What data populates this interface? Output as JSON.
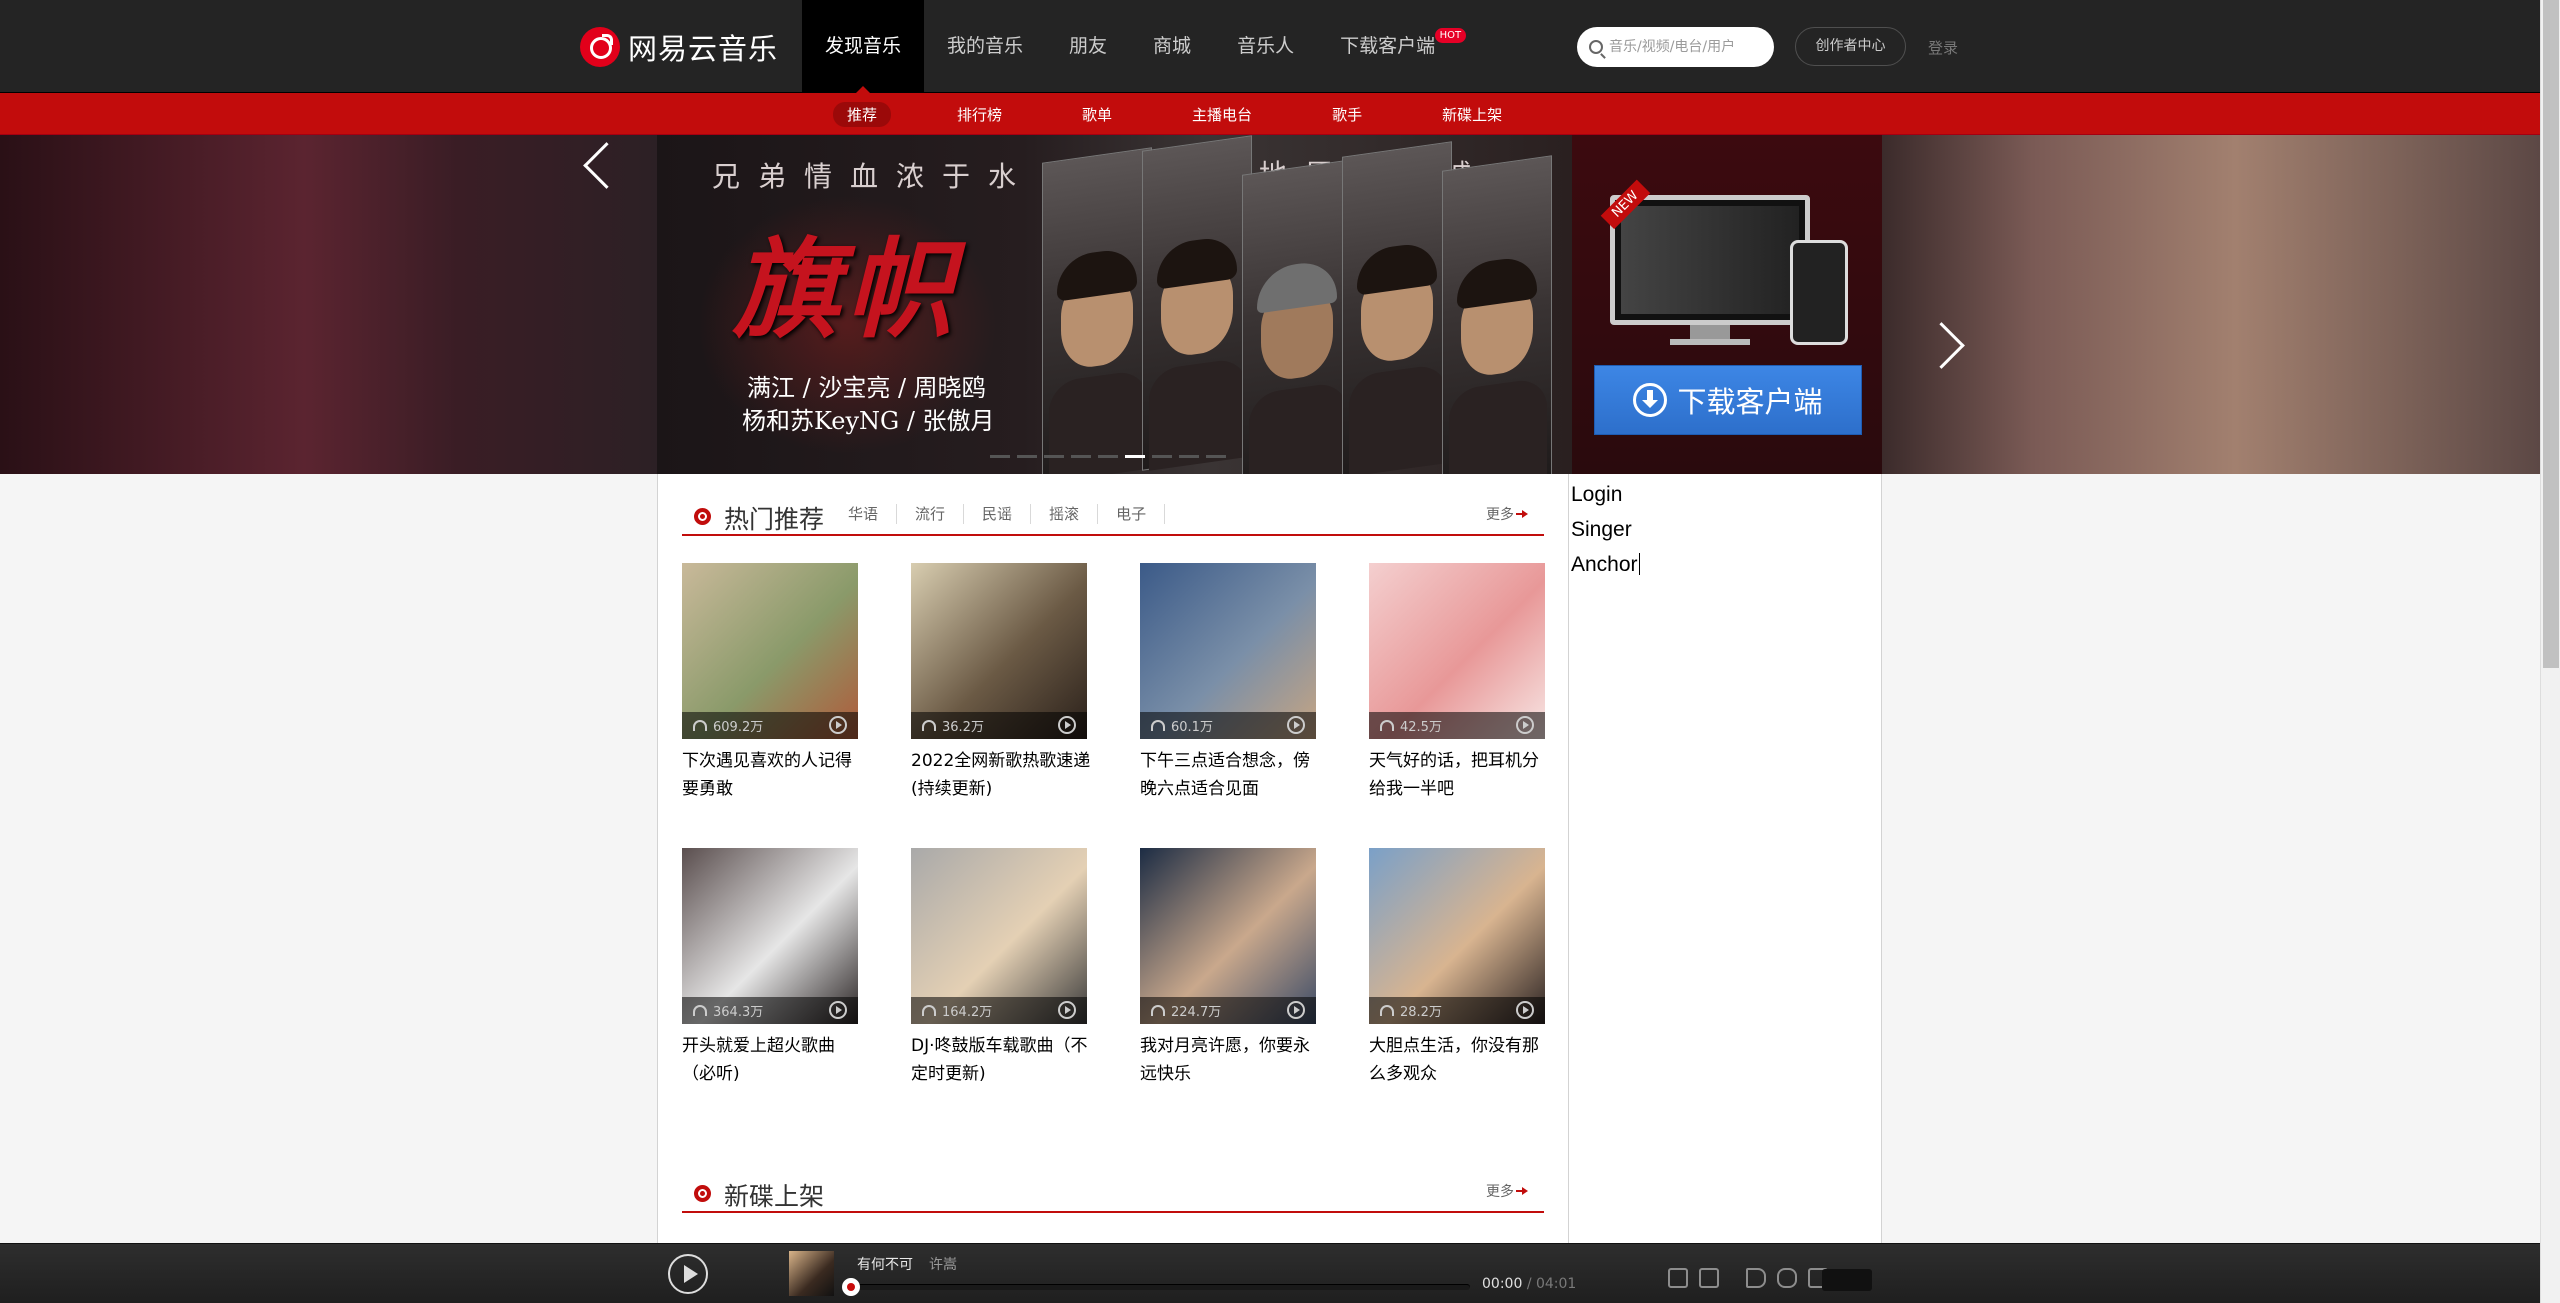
{
  "header": {
    "logo_text": "网易云音乐",
    "nav": [
      {
        "label": "发现音乐",
        "active": true
      },
      {
        "label": "我的音乐",
        "active": false
      },
      {
        "label": "朋友",
        "active": false
      },
      {
        "label": "商城",
        "active": false
      },
      {
        "label": "音乐人",
        "active": false
      },
      {
        "label": "下载客户端",
        "active": false
      }
    ],
    "hot_badge": "HOT",
    "search_placeholder": "音乐/视频/电台/用户",
    "creator_center": "创作者中心",
    "login": "登录"
  },
  "subnav": {
    "items": [
      "推荐",
      "排行榜",
      "歌单",
      "主播电台",
      "歌手",
      "新碟上架"
    ],
    "active_index": 0
  },
  "banner": {
    "tagline_left": "兄弟情血浓于水",
    "tagline_right": "向天地展现赤诚",
    "title": "旗帜",
    "cast_line1": "满江 / 沙宝亮 / 周晓鸥",
    "cast_line2": "杨和苏KeyNG / 张傲月",
    "dots_total": 9,
    "dots_active": 5,
    "download_new": "NEW",
    "download_button": "下载客户端"
  },
  "hot_section": {
    "title": "热门推荐",
    "tags": [
      "华语",
      "流行",
      "民谣",
      "摇滚",
      "电子"
    ],
    "more": "更多",
    "playlists": [
      {
        "plays": "609.2万",
        "title": "下次遇见喜欢的人记得要勇敢",
        "colors": [
          "#c9b99a",
          "#8a9a6a",
          "#b05a3a"
        ]
      },
      {
        "plays": "36.2万",
        "title": "2022全网新歌热歌速递(持续更新)",
        "colors": [
          "#d8cdb0",
          "#6b5a45",
          "#2a201a"
        ]
      },
      {
        "plays": "60.1万",
        "title": "下午三点适合想念，傍晚六点适合见面",
        "colors": [
          "#3b5a88",
          "#7a8fa8",
          "#c7a582"
        ]
      },
      {
        "plays": "42.5万",
        "title": "天气好的话，把耳机分给我一半吧",
        "colors": [
          "#f4cfcf",
          "#e89898",
          "#f7e6e4"
        ]
      },
      {
        "plays": "364.3万",
        "title": "开头就爱上超火歌曲（必听)",
        "colors": [
          "#5a4e4e",
          "#e6e6e6",
          "#2a2424"
        ]
      },
      {
        "plays": "164.2万",
        "title": "DJ·咚鼓版车载歌曲（不定时更新)",
        "colors": [
          "#a9a9a9",
          "#e4d0b4",
          "#3a3a3a"
        ]
      },
      {
        "plays": "224.7万",
        "title": "我对月亮许愿，你要永远快乐",
        "colors": [
          "#1c2c44",
          "#c9a88c",
          "#3a4a66"
        ]
      },
      {
        "plays": "28.2万",
        "title": "大胆点生活，你没有那么多观众",
        "colors": [
          "#7aa0c8",
          "#d8b490",
          "#2a2222"
        ]
      }
    ]
  },
  "new_album_section": {
    "title": "新碟上架",
    "more": "更多"
  },
  "sidebar_lines": [
    "Login",
    "Singer",
    "Anchor"
  ],
  "player": {
    "song": "有何不可",
    "artist": "许嵩",
    "current_time": "00:00",
    "total_time": "/ 04:01",
    "progress": 0
  }
}
